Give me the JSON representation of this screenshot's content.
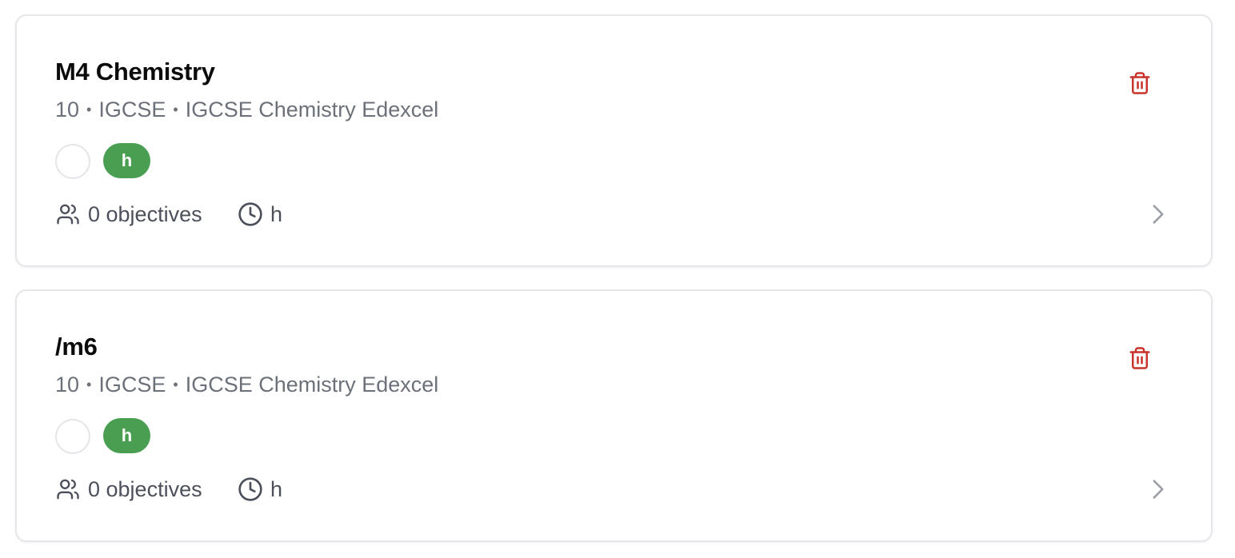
{
  "colors": {
    "tag_bg": "#4a9e52",
    "delete_icon": "#c8332b",
    "meta_text": "#6b7079",
    "card_border": "#e6e7ea"
  },
  "cards": [
    {
      "title": "M4 Chemistry",
      "grade": "10",
      "level": "IGCSE",
      "course": "IGCSE Chemistry Edexcel",
      "separator": "•",
      "tag": "h",
      "objectives": "0 objectives",
      "duration": "h",
      "icons": {
        "people": "users-icon",
        "clock": "clock-icon",
        "delete": "trash-icon",
        "open": "chevron-right-icon"
      }
    },
    {
      "title": "/m6",
      "grade": "10",
      "level": "IGCSE",
      "course": "IGCSE Chemistry Edexcel",
      "separator": "•",
      "tag": "h",
      "objectives": "0 objectives",
      "duration": "h",
      "icons": {
        "people": "users-icon",
        "clock": "clock-icon",
        "delete": "trash-icon",
        "open": "chevron-right-icon"
      }
    }
  ]
}
